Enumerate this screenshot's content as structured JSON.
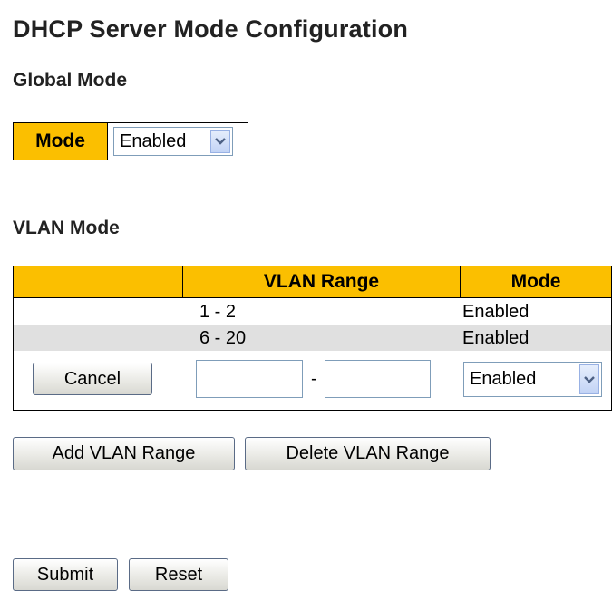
{
  "page": {
    "title": "DHCP Server Mode Configuration"
  },
  "global_mode": {
    "heading": "Global Mode",
    "label": "Mode",
    "selected": "Enabled"
  },
  "vlan_mode": {
    "heading": "VLAN Mode",
    "columns": [
      "",
      "VLAN Range",
      "Mode"
    ],
    "rows": [
      {
        "range": "1 - 2",
        "mode": "Enabled"
      },
      {
        "range": "6 - 20",
        "mode": "Enabled"
      }
    ],
    "new_row": {
      "cancel_label": "Cancel",
      "range_start": "",
      "range_separator": "-",
      "range_end": "",
      "mode_selected": "Enabled"
    }
  },
  "actions": {
    "add_label": "Add VLAN Range",
    "delete_label": "Delete VLAN Range",
    "submit_label": "Submit",
    "reset_label": "Reset"
  },
  "colors": {
    "header_bg": "#fbbf00",
    "alt_row_bg": "#e0e0e0"
  },
  "icons": {
    "dropdown": "chevron-down-icon"
  }
}
